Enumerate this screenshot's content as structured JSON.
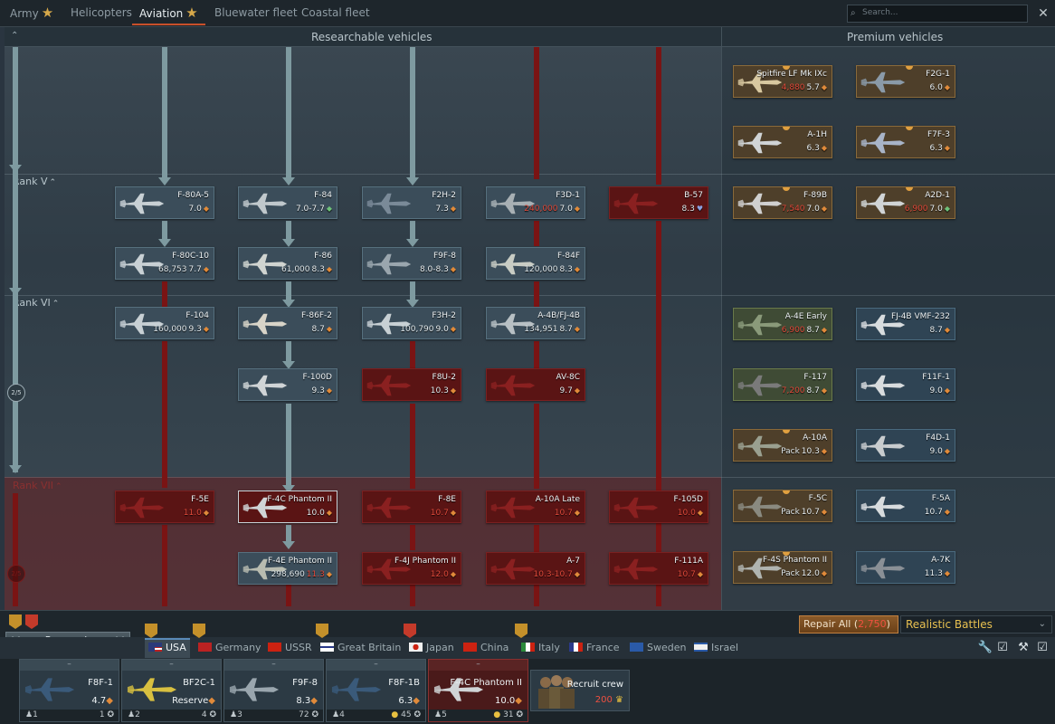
{
  "tabs": [
    {
      "label": "Army",
      "star": true,
      "active": false
    },
    {
      "label": "Helicopters",
      "star": false,
      "active": false
    },
    {
      "label": "Aviation",
      "star": true,
      "active": true
    },
    {
      "label": "Bluewater fleet",
      "star": false,
      "active": false
    },
    {
      "label": "Coastal fleet",
      "star": false,
      "active": false
    }
  ],
  "search": {
    "placeholder": "Search..."
  },
  "close_label": "✕",
  "sections": {
    "researchable": "Researchable vehicles",
    "premium": "Premium vehicles"
  },
  "ranks": {
    "v": "Rank V",
    "vi": "Rank VI",
    "vii": "Rank VII"
  },
  "progress": {
    "rank_vi": "2/5",
    "rank_vii": "2/5"
  },
  "vehicles": {
    "f80a5": {
      "name": "F-80A-5",
      "br": "7.0"
    },
    "f84": {
      "name": "F-84",
      "br": "7.0-7.7"
    },
    "f2h2": {
      "name": "F2H-2",
      "br": "7.3"
    },
    "f3d1": {
      "name": "F3D-1",
      "cost": "240,000",
      "br": "7.0"
    },
    "b57": {
      "name": "B-57",
      "br": "8.3"
    },
    "f80c10": {
      "name": "F-80C-10",
      "rp": "68,753",
      "br": "7.7"
    },
    "f86": {
      "name": "F-86",
      "rp": "61,000",
      "br": "8.3"
    },
    "f9f8": {
      "name": "F9F-8",
      "br": "8.0-8.3"
    },
    "f84f": {
      "name": "F-84F",
      "rp": "120,000",
      "br": "8.3"
    },
    "f104": {
      "name": "F-104",
      "rp": "160,000",
      "br": "9.3"
    },
    "f86f2": {
      "name": "F-86F-2",
      "br": "8.7"
    },
    "f3h2": {
      "name": "F3H-2",
      "rp": "100,790",
      "br": "9.0"
    },
    "a4b": {
      "name": "A-4B/FJ-4B",
      "rp": "134,951",
      "br": "8.7"
    },
    "f100d": {
      "name": "F-100D",
      "br": "9.3"
    },
    "f8u2": {
      "name": "F8U-2",
      "br": "10.3"
    },
    "av8c": {
      "name": "AV-8C",
      "br": "9.7"
    },
    "f5e": {
      "name": "F-5E",
      "br": "11.0"
    },
    "f4c": {
      "name": "F-4C Phantom II",
      "br": "10.0"
    },
    "f8e": {
      "name": "F-8E",
      "br": "10.7"
    },
    "a10late": {
      "name": "A-10A Late",
      "br": "10.7"
    },
    "f105d": {
      "name": "F-105D",
      "br": "10.0"
    },
    "f4e": {
      "name": "F-4E Phantom II",
      "rp": "298,690",
      "br": "11.3"
    },
    "f4j": {
      "name": "F-4J Phantom II",
      "br": "12.0"
    },
    "a7": {
      "name": "A-7",
      "br": "10.3-10.7"
    },
    "f111a": {
      "name": "F-111A",
      "br": "10.7"
    }
  },
  "premium": {
    "spitfire": {
      "name": "Spitfire LF Mk IXc",
      "cost": "4,880",
      "br": "5.7"
    },
    "f2g1": {
      "name": "F2G-1",
      "br": "6.0"
    },
    "a1h": {
      "name": "A-1H",
      "br": "6.3"
    },
    "f7f3": {
      "name": "F7F-3",
      "br": "6.3"
    },
    "f89b": {
      "name": "F-89B",
      "cost": "7,540",
      "br": "7.0"
    },
    "a2d1": {
      "name": "A2D-1",
      "cost": "6,900",
      "br": "7.0"
    },
    "a4e": {
      "name": "A-4E Early",
      "cost": "6,900",
      "br": "8.7"
    },
    "fj4b": {
      "name": "FJ-4B VMF-232",
      "br": "8.7"
    },
    "f117": {
      "name": "F-117",
      "cost": "7,200",
      "br": "8.7"
    },
    "f11f1": {
      "name": "F11F-1",
      "br": "9.0"
    },
    "a10a": {
      "name": "A-10A",
      "pack": "Pack",
      "br": "10.3"
    },
    "f4d1": {
      "name": "F4D-1",
      "br": "9.0"
    },
    "f5c": {
      "name": "F-5C",
      "pack": "Pack",
      "br": "10.7"
    },
    "f5a": {
      "name": "F-5A",
      "br": "10.7"
    },
    "f4s": {
      "name": "F-4S Phantom II",
      "pack": "Pack",
      "br": "12.0"
    },
    "a7k": {
      "name": "A-7K",
      "br": "11.3"
    }
  },
  "bottom": {
    "research": "Research",
    "repair_label": "Repair All (",
    "repair_cost": "2,750",
    "repair_close": ")",
    "mode": "Realistic Battles"
  },
  "nations": [
    "USA",
    "Germany",
    "USSR",
    "Great Britain",
    "Japan",
    "China",
    "Italy",
    "France",
    "Sweden",
    "Israel"
  ],
  "crew": [
    {
      "slot": "1",
      "name": "F8F-1",
      "br": "4.7",
      "count": "1"
    },
    {
      "slot": "2",
      "name": "BF2C-1",
      "br": "Reserve",
      "count": "4"
    },
    {
      "slot": "3",
      "name": "F9F-8",
      "br": "8.3",
      "count": "72"
    },
    {
      "slot": "4",
      "name": "F8F-1B",
      "br": "6.3",
      "count": "45"
    },
    {
      "slot": "5",
      "name": "F-4C Phantom II",
      "br": "10.0",
      "count": "31"
    }
  ],
  "slot_dash": "–",
  "recruit": {
    "label": "Recruit crew",
    "cost": "200"
  },
  "colors": {
    "accent": "#c8502a",
    "locked": "#7a1414",
    "teal": "#7e9aa0",
    "gold": "#d6a84a"
  }
}
